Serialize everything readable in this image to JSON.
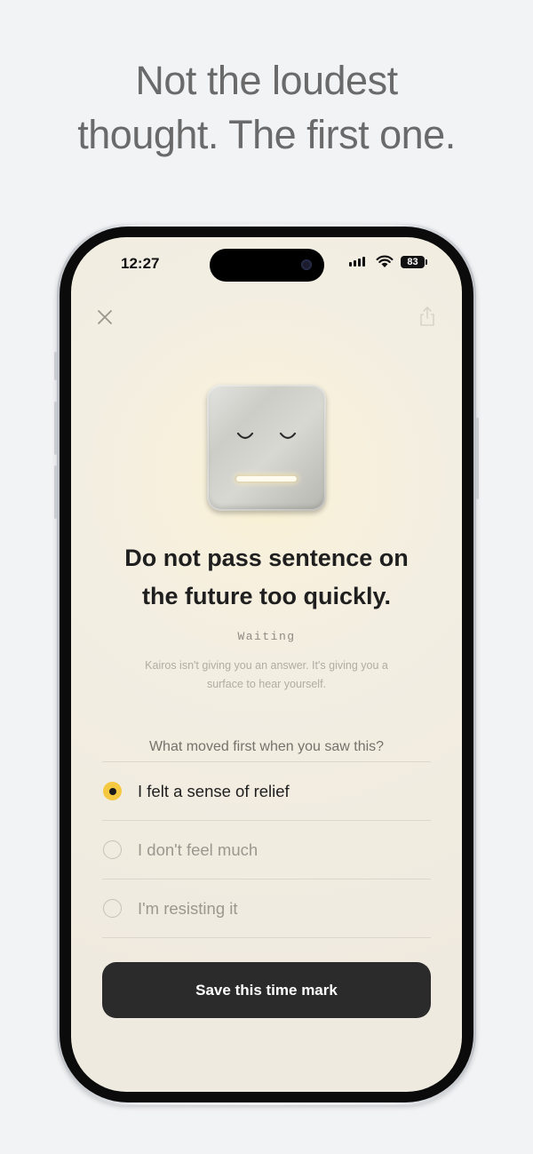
{
  "headline": {
    "line1": "Not the loudest",
    "line2": "thought. The first one."
  },
  "status_bar": {
    "time": "12:27",
    "battery": "83",
    "icons": [
      "signal-icon",
      "wifi-icon",
      "battery-icon"
    ]
  },
  "toolbar": {
    "close_icon": "close-icon",
    "share_icon": "share-icon"
  },
  "card": {
    "title_line1": "Do not pass sentence on",
    "title_line2": "the future too quickly.",
    "status": "Waiting",
    "subtext_line1": "Kairos isn't giving you an answer. It's giving you a",
    "subtext_line2": "surface to hear yourself."
  },
  "question": "What moved first when you saw this?",
  "options": [
    {
      "label": "I felt a sense of relief",
      "selected": true
    },
    {
      "label": "I don't feel much",
      "selected": false
    },
    {
      "label": "I'm resisting it",
      "selected": false
    }
  ],
  "save_button": "Save this time mark",
  "colors": {
    "accent": "#f5c842",
    "button": "#2b2b2b",
    "background": "#efeadf"
  }
}
